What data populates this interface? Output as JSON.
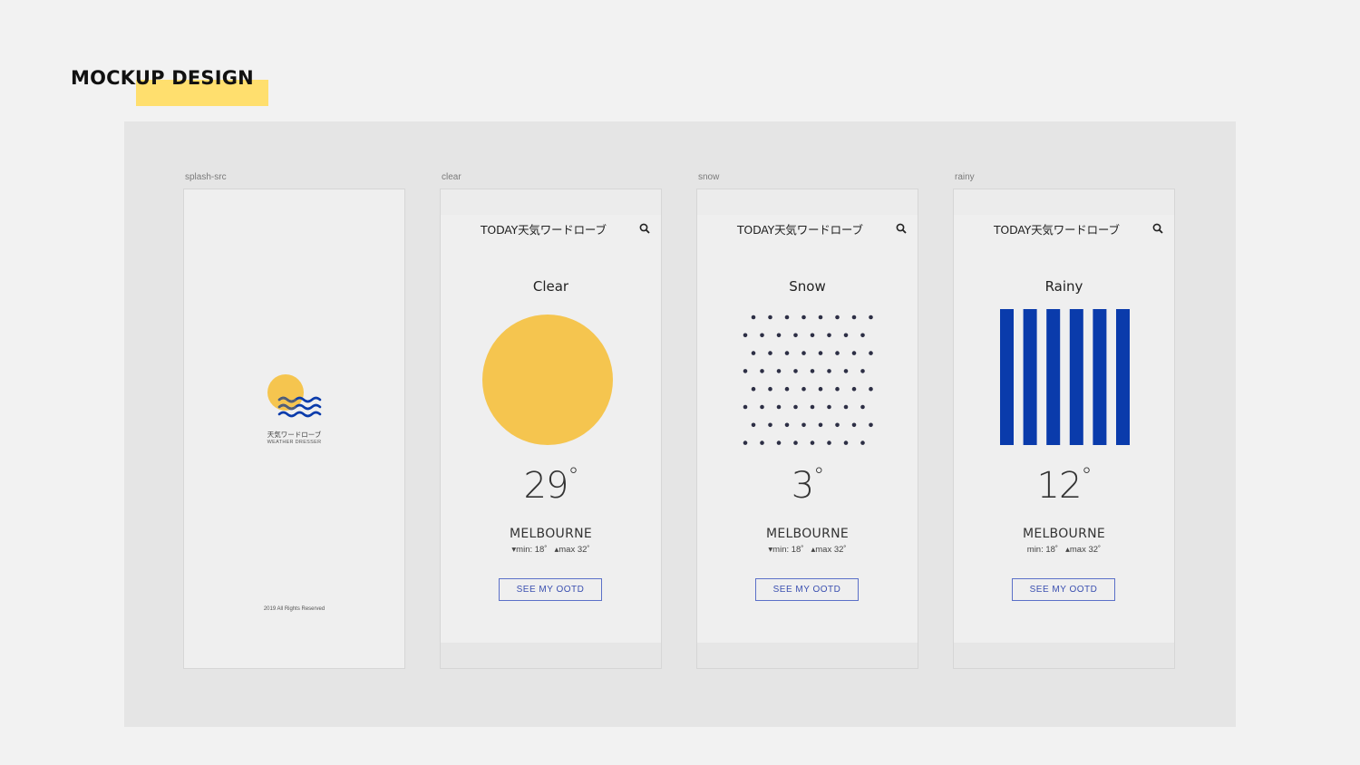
{
  "page": {
    "title": "MOCKUP DESIGN",
    "highlight_color": "#ffdf6e"
  },
  "splash": {
    "frame_label": "splash-src",
    "logo_jp": "天気ワードローブ",
    "logo_en": "WEATHER DRESSER",
    "footer": "2019 All Rights Reserved",
    "icon": "sun-waves-logo-icon"
  },
  "screens": [
    {
      "frame_label": "clear",
      "header": "TODAY天気ワードローブ",
      "condition": "Clear",
      "temperature": "29",
      "degree": "°",
      "city": "MELBOURNE",
      "min": "▾min: 18˚",
      "max": "▴max 32˚",
      "button": "SEE MY OOTD",
      "art": "sun-circle-icon",
      "art_color": "#f5c54f"
    },
    {
      "frame_label": "snow",
      "header": "TODAY天気ワードローブ",
      "condition": "Snow",
      "temperature": "3",
      "degree": "°",
      "city": "MELBOURNE",
      "min": "▾min: 18˚",
      "max": "▴max 32˚",
      "button": "SEE MY OOTD",
      "art": "snow-dots-icon",
      "art_color": "#2d2f45"
    },
    {
      "frame_label": "rainy",
      "header": "TODAY天気ワードローブ",
      "condition": "Rainy",
      "temperature": "12",
      "degree": "°",
      "city": "MELBOURNE",
      "min": "min: 18˚",
      "max": "▴max 32˚",
      "button": "SEE MY OOTD",
      "art": "rain-bars-icon",
      "art_color": "#0a3bab"
    }
  ],
  "colors": {
    "background": "#f2f2f2",
    "canvas": "#e5e5e5",
    "button_border": "#5b70c8",
    "sun": "#f5c54f",
    "rain_blue": "#0a3bab"
  }
}
